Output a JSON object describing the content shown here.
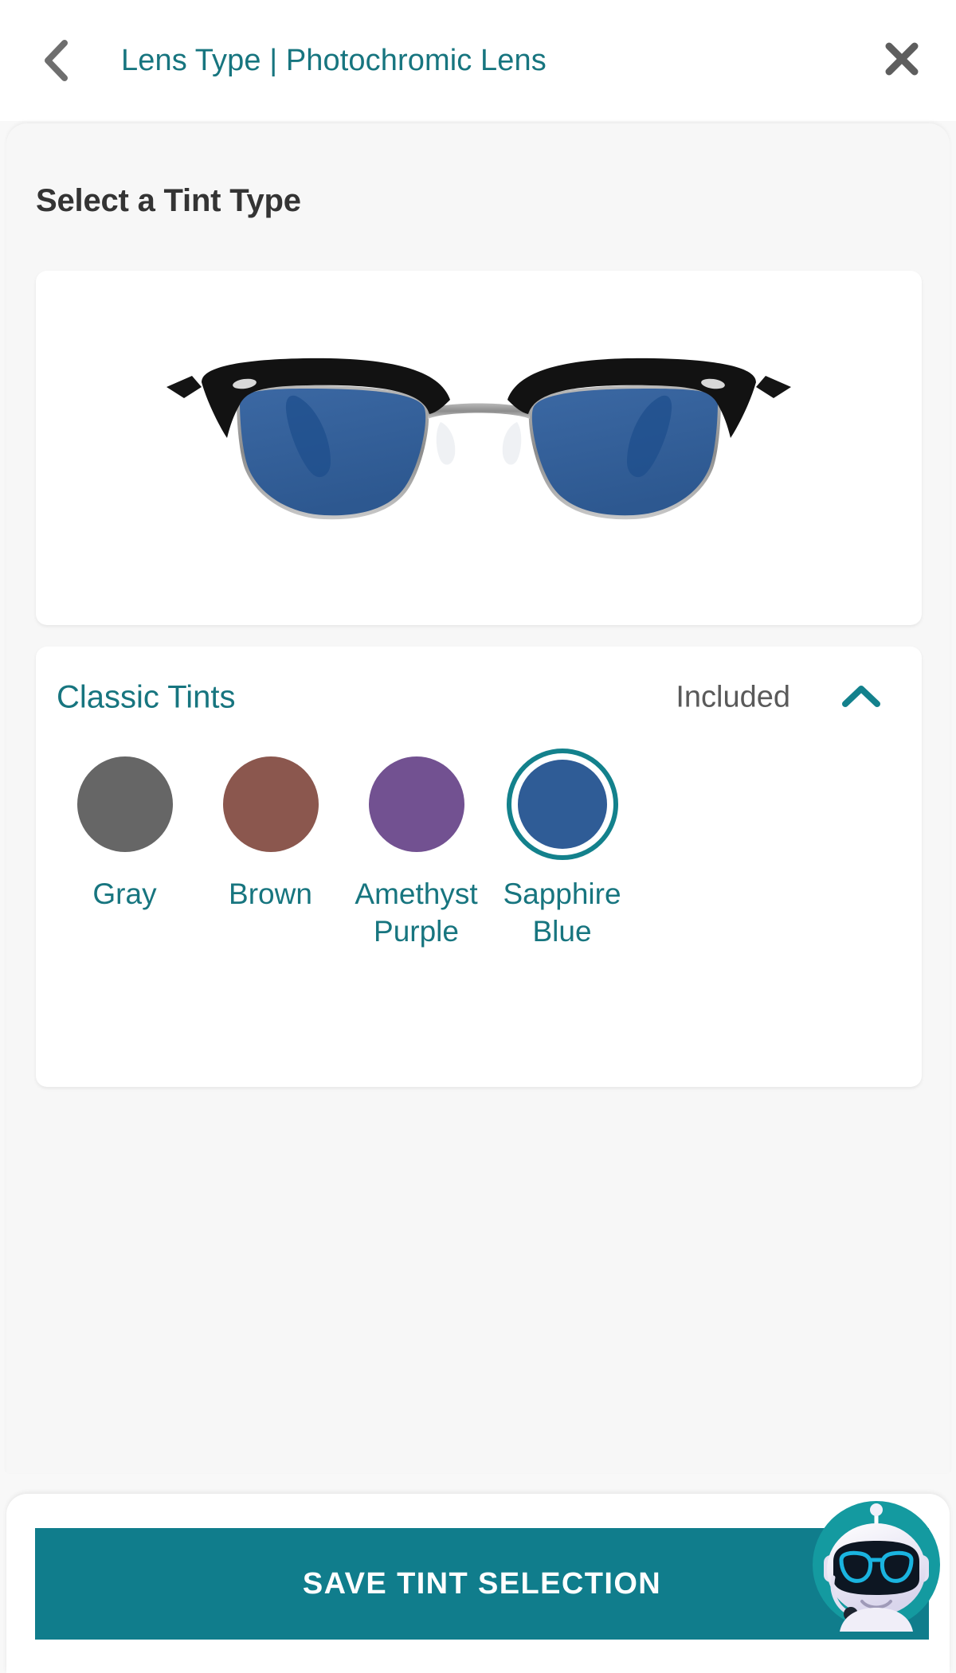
{
  "header": {
    "back_icon": "chevron-left-icon",
    "title": "Lens Type | Photochromic Lens",
    "close_icon": "close-icon"
  },
  "main": {
    "title": "Select a Tint Type",
    "preview": {
      "alt": "eyeglasses-preview",
      "lens_color": "#33609c",
      "frame_top_color": "#121212",
      "frame_rim_color": "#8b8b8b"
    },
    "section": {
      "title": "Classic Tints",
      "price": "Included",
      "expanded": true,
      "chevron_icon": "chevron-up-icon",
      "swatches": [
        {
          "label": "Gray",
          "color": "#666666",
          "selected": false
        },
        {
          "label": "Brown",
          "color": "#8b574e",
          "selected": false
        },
        {
          "label": "Amethyst Purple",
          "color": "#725191",
          "selected": false
        },
        {
          "label": "Sapphire Blue",
          "color": "#2f5c96",
          "selected": true
        }
      ]
    }
  },
  "footer": {
    "save_label": "SAVE TINT SELECTION",
    "chatbot_icon": "chatbot-avatar-icon"
  },
  "colors": {
    "accent_teal": "#17757f",
    "button_teal": "#107d8c",
    "ring_teal": "#13818c",
    "page_bg": "#f8f8f8",
    "text_dark": "#343434",
    "text_gray": "#5a5a5a"
  }
}
